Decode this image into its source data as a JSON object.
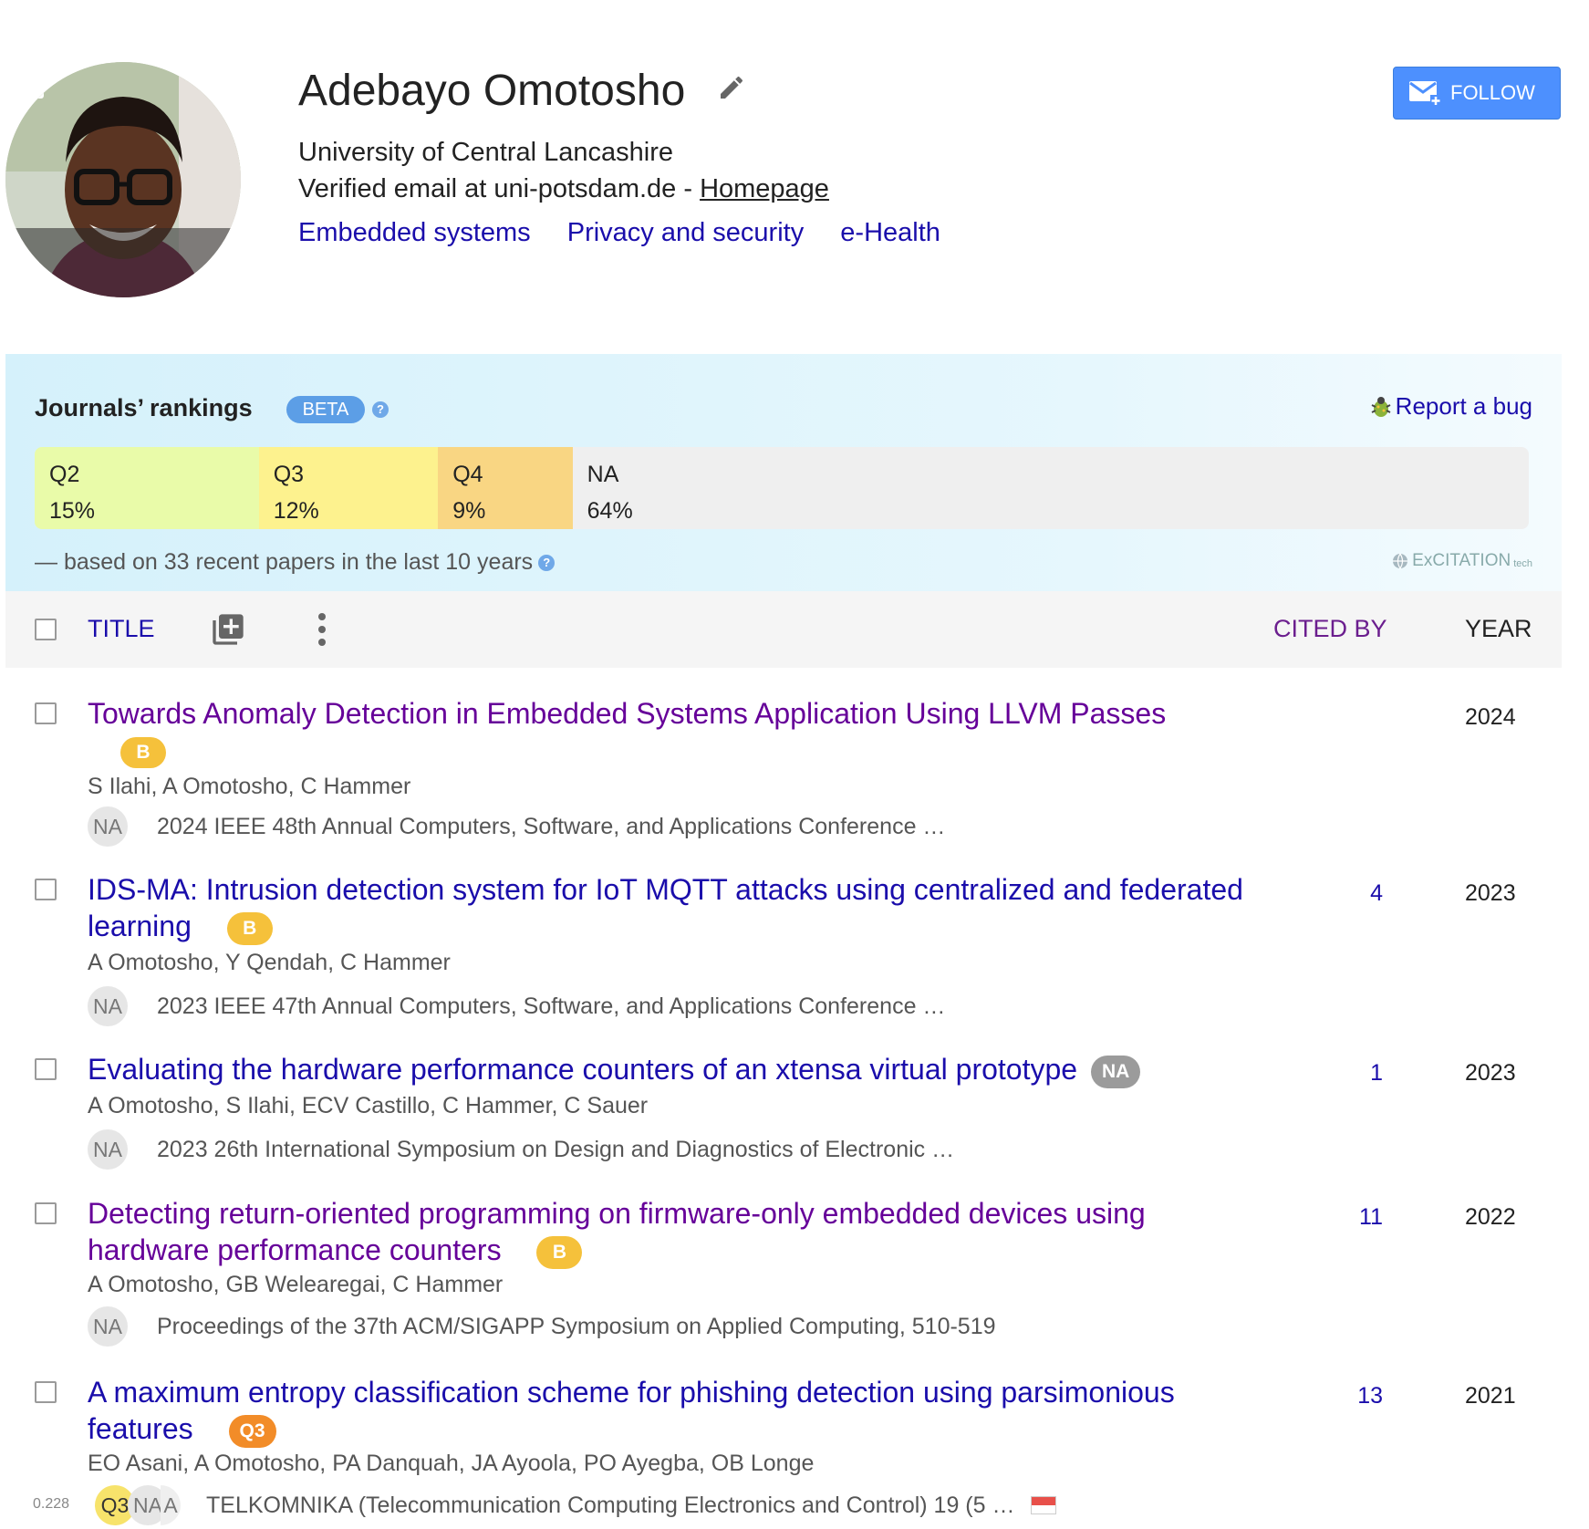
{
  "profile": {
    "name": "Adebayo Omotosho",
    "affiliation": "University of Central Lancashire",
    "email_text": "Verified email at uni-potsdam.de - ",
    "homepage_label": "Homepage",
    "interests": [
      "Embedded systems",
      "Privacy and security",
      "e-Health"
    ],
    "follow_label": "FOLLOW"
  },
  "rankings": {
    "title": "Journals’ rankings",
    "beta": "BETA",
    "help": "?",
    "report_bug": "Report a bug",
    "segments": [
      {
        "label": "Q2",
        "percent": "15%",
        "fraction": 0.15,
        "color": "#e9fba9"
      },
      {
        "label": "Q3",
        "percent": "12%",
        "fraction": 0.12,
        "color": "#fdf28e"
      },
      {
        "label": "Q4",
        "percent": "9%",
        "fraction": 0.09,
        "color": "#f9d683"
      },
      {
        "label": "NA",
        "percent": "64%",
        "fraction": 0.64,
        "color": "#efefef"
      }
    ],
    "based_on": "— based on 33 recent papers in the last 10 years",
    "brand": "ExCITATION",
    "brand_suffix": "tech"
  },
  "table": {
    "title_col": "TITLE",
    "cited_col": "CITED BY",
    "year_col": "YEAR"
  },
  "papers": [
    {
      "title": "Towards Anomaly Detection in Embedded Systems Application Using LLVM Passes",
      "badge": "B",
      "authors": "S Ilahi, A Omotosho, C Hammer",
      "rank": "NA",
      "venue": "2024 IEEE 48th Annual Computers, Software, and Applications Conference …",
      "cited": "",
      "year": "2024"
    },
    {
      "title": "IDS-MA: Intrusion detection system for IoT MQTT attacks using centralized and federated learning",
      "badge": "B",
      "authors": "A Omotosho, Y Qendah, C Hammer",
      "rank": "NA",
      "venue": "2023 IEEE 47th Annual Computers, Software, and Applications Conference …",
      "cited": "4",
      "year": "2023"
    },
    {
      "title": "Evaluating the hardware performance counters of an xtensa virtual prototype",
      "badge": "NA",
      "authors": "A Omotosho, S Ilahi, ECV Castillo, C Hammer, C Sauer",
      "rank": "NA",
      "venue": "2023 26th International Symposium on Design and Diagnostics of Electronic …",
      "cited": "1",
      "year": "2023"
    },
    {
      "title": "Detecting return-oriented programming on firmware-only embedded devices using hardware performance counters",
      "badge": "B",
      "authors": "A Omotosho, GB Welearegai, C Hammer",
      "rank": "NA",
      "venue": "Proceedings of the 37th ACM/SIGAPP Symposium on Applied Computing, 510-519",
      "cited": "11",
      "year": "2022"
    },
    {
      "title": "A maximum entropy classification scheme for phishing detection using parsimonious features",
      "badge": "Q3",
      "authors": "EO Asani, A Omotosho, PA Danquah, JA Ayoola, PO Ayegba, OB Longe",
      "score": "0.228",
      "rank_primary": "Q3",
      "rank": "NA",
      "rank_tail": "A",
      "venue": "TELKOMNIKA (Telecommunication Computing Electronics and Control) 19 (5 …",
      "cited": "13",
      "year": "2021"
    }
  ]
}
